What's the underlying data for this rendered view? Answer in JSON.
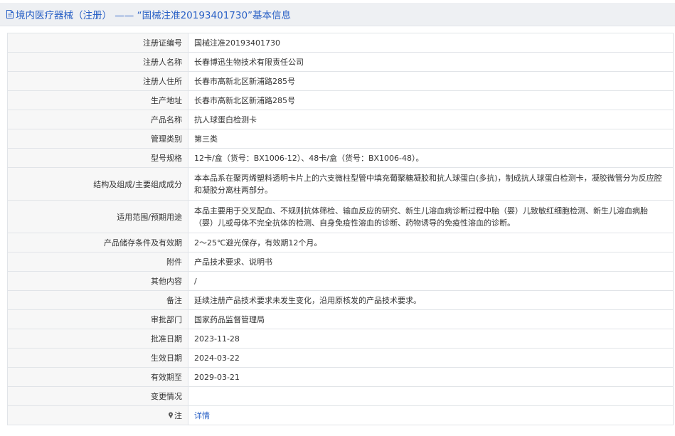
{
  "header": {
    "title": "境内医疗器械（注册） —— “国械注准20193401730”基本信息"
  },
  "rows": [
    {
      "label": "注册证编号",
      "value": "国械注准20193401730"
    },
    {
      "label": "注册人名称",
      "value": "长春博迅生物技术有限责任公司"
    },
    {
      "label": "注册人住所",
      "value": "长春市高新北区新浦路285号"
    },
    {
      "label": "生产地址",
      "value": "长春市高新北区新浦路285号"
    },
    {
      "label": "产品名称",
      "value": "抗人球蛋白检测卡"
    },
    {
      "label": "管理类别",
      "value": "第三类"
    },
    {
      "label": "型号规格",
      "value": "12卡/盒（货号：BX1006-12）、48卡/盒（货号：BX1006-48）。"
    },
    {
      "label": "结构及组成/主要组成成分",
      "value": "本本品系在聚丙烯塑料透明卡片上的六支微柱型管中填充葡聚糖凝胶和抗人球蛋白(多抗)，制成抗人球蛋白检测卡，凝胶微管分为反应腔和凝胶分离柱两部分。"
    },
    {
      "label": "适用范围/预期用途",
      "value": "本品主要用于交叉配血、不规则抗体筛检、输血反应的研究、新生儿溶血病诊断过程中胎（婴）儿致敏红细胞检测、新生儿溶血病胎（婴）儿或母体不完全抗体的检测、自身免疫性溶血的诊断、药物诱导的免疫性溶血的诊断。"
    },
    {
      "label": "产品储存条件及有效期",
      "value": "2～25℃避光保存，有效期12个月。"
    },
    {
      "label": "附件",
      "value": "产品技术要求、说明书"
    },
    {
      "label": "其他内容",
      "value": "/"
    },
    {
      "label": "备注",
      "value": "延续注册产品技术要求未发生变化，沿用原核发的产品技术要求。"
    },
    {
      "label": "审批部门",
      "value": "国家药品监督管理局"
    },
    {
      "label": "批准日期",
      "value": "2023-11-28"
    },
    {
      "label": "生效日期",
      "value": "2024-03-22"
    },
    {
      "label": "有效期至",
      "value": "2029-03-21"
    },
    {
      "label": "变更情况",
      "value": ""
    }
  ],
  "note": {
    "label": "注",
    "link_text": "详情"
  },
  "colors": {
    "accent": "#2a61c6",
    "label_bg": "#f7f7f7",
    "border": "#e1e4e8"
  }
}
